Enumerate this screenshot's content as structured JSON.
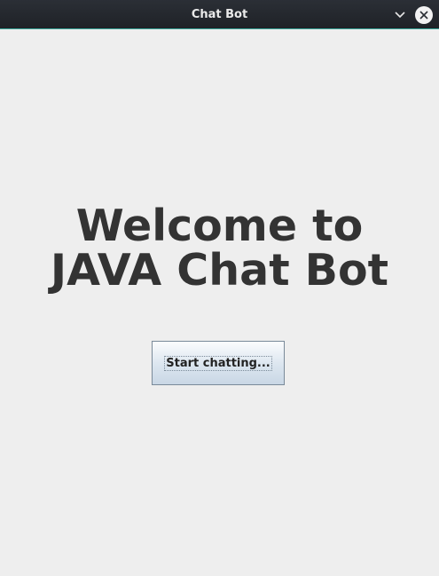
{
  "window": {
    "title": "Chat Bot"
  },
  "titlebar_icons": {
    "minimize": "chevron-down-icon",
    "close": "close-icon"
  },
  "main": {
    "welcome_line1": "Welcome to",
    "welcome_line2": "JAVA Chat Bot",
    "start_button_label": "Start chatting..."
  },
  "colors": {
    "background": "#eeeeee",
    "titlebar": "#23272d",
    "text": "#333333",
    "button_gradient_top": "#fbfcfd",
    "button_gradient_bottom": "#c9d7e5"
  }
}
